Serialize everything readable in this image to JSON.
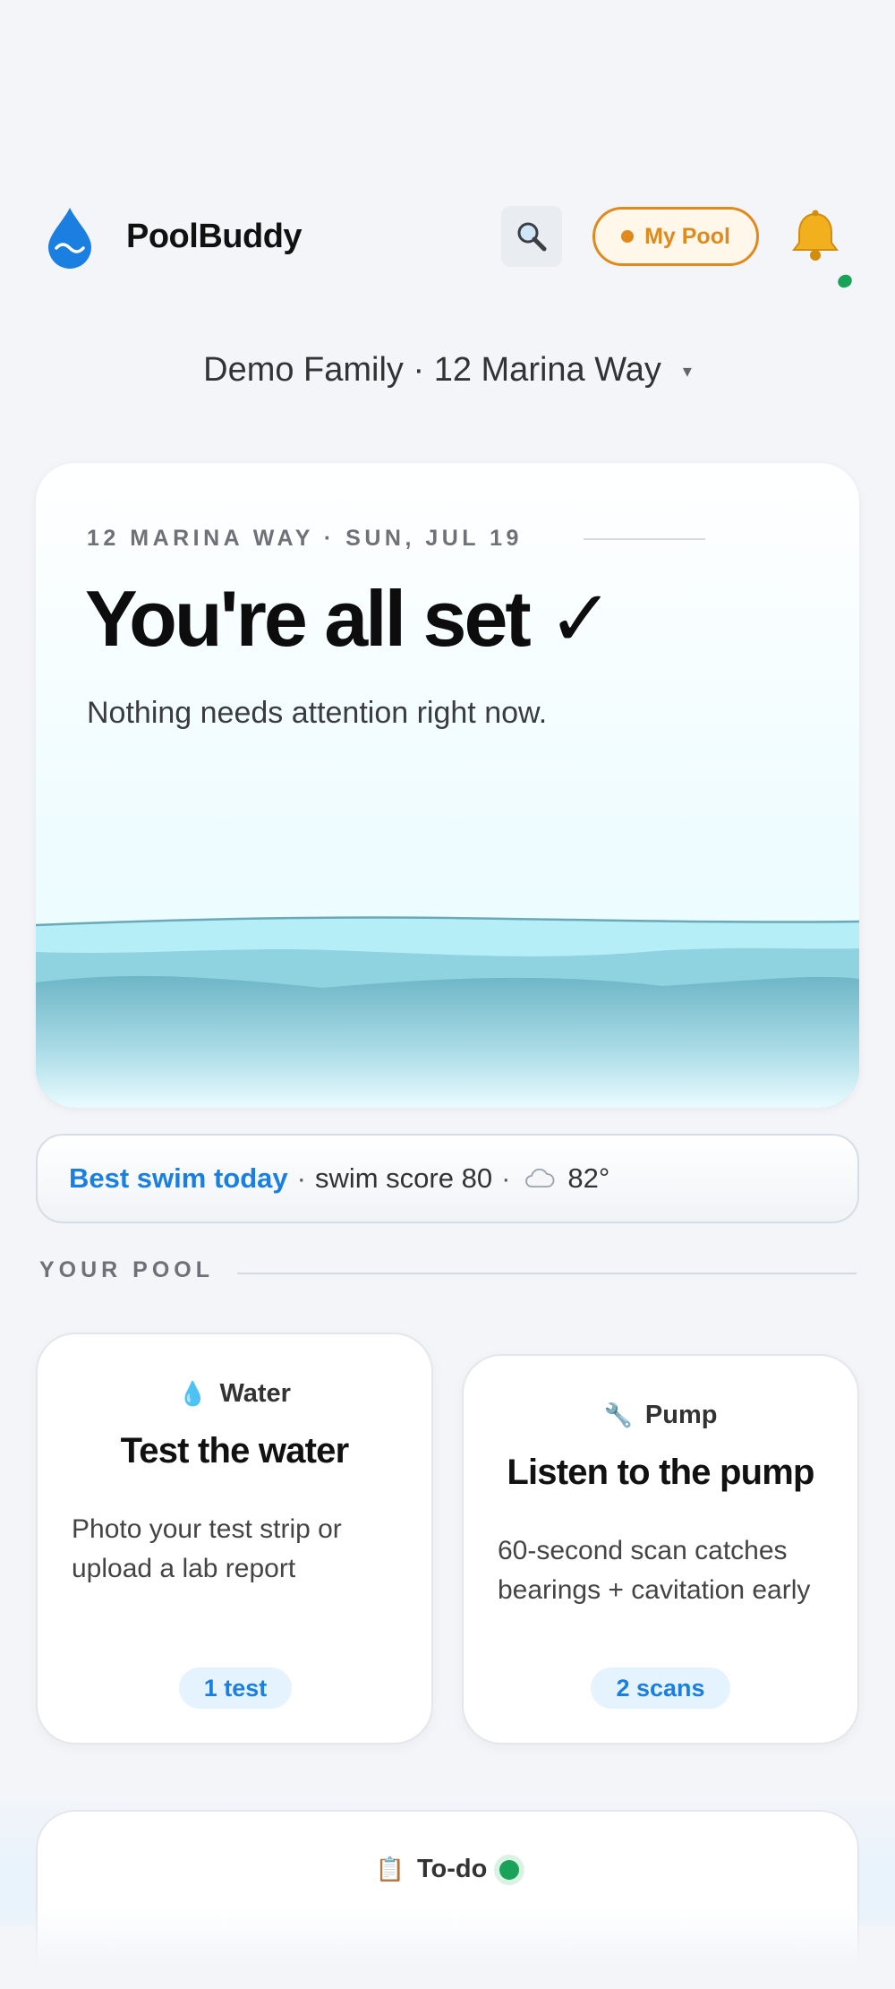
{
  "header": {
    "app_name": "PoolBuddy",
    "my_pool_label": "My Pool",
    "accent": "#e08a1e",
    "brand": "#1a7fe0",
    "icons": [
      "water-drop-logo-icon",
      "search-icon",
      "bell-icon"
    ]
  },
  "household": {
    "label": "Demo Family · 12 Marina Way",
    "caret": "▾"
  },
  "hero": {
    "meta": "12 MARINA WAY · SUN, JUL 19",
    "title": "You're all set ✓",
    "subtitle": "Nothing needs attention right now."
  },
  "swim": {
    "best": "Best swim today",
    "score_text": "swim score 80",
    "sep": "·",
    "temp": "82°",
    "weather_icon": "cloud-icon"
  },
  "section": {
    "title": "YOUR POOL"
  },
  "cards": {
    "water": {
      "icon_glyph": "💧",
      "label": "Water",
      "title": "Test the water",
      "desc": "Photo your test strip or upload a lab report",
      "chip": "1 test"
    },
    "pump": {
      "icon_glyph": "🔧",
      "label": "Pump",
      "title": "Listen to the pump",
      "desc": "60-second scan catches bearings + cavitation early",
      "chip": "2 scans"
    }
  },
  "todo": {
    "icon_glyph": "📋",
    "label": "To-do",
    "status_color": "#1aa358"
  }
}
